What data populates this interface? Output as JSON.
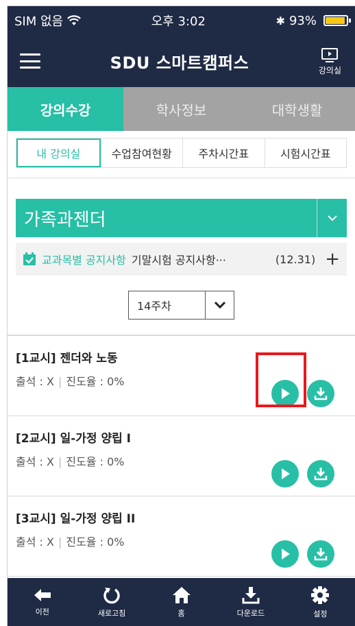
{
  "status_bar": {
    "carrier": "SIM 없음",
    "time": "오후 3:02",
    "battery": "93%",
    "battery_level": 0.93
  },
  "header": {
    "title": "SDU 스마트캠퍼스",
    "right_label": "강의실"
  },
  "main_tabs": [
    {
      "label": "강의수강",
      "active": true
    },
    {
      "label": "학사정보",
      "active": false
    },
    {
      "label": "대학생활",
      "active": false
    }
  ],
  "sub_tabs": [
    {
      "label": "내 강의실",
      "active": true
    },
    {
      "label": "수업참여현황",
      "active": false
    },
    {
      "label": "주차시간표",
      "active": false
    },
    {
      "label": "시험시간표",
      "active": false
    }
  ],
  "course": {
    "name": "가족과젠더"
  },
  "notice": {
    "label": "교과목별 공지사항",
    "text": "기말시험 공지사항···",
    "date": "(12.31)",
    "plus": "+"
  },
  "week_select": {
    "value": "14주차"
  },
  "lectures": [
    {
      "title": "[1교시] 젠더와 노동",
      "attendance": "출석 : X",
      "progress": "진도율 : 0%"
    },
    {
      "title": "[2교시] 일-가정 양립 I",
      "attendance": "출석 : X",
      "progress": "진도율 : 0%"
    },
    {
      "title": "[3교시] 일-가정 양립 II",
      "attendance": "출석 : X",
      "progress": "진도율 : 0%"
    }
  ],
  "bottom_nav": [
    {
      "label": "이전",
      "icon": "arrow-left-icon"
    },
    {
      "label": "새로고침",
      "icon": "refresh-icon"
    },
    {
      "label": "홈",
      "icon": "home-icon"
    },
    {
      "label": "다운로드",
      "icon": "download-icon"
    },
    {
      "label": "설정",
      "icon": "gear-icon"
    }
  ],
  "colors": {
    "navy": "#1f2a44",
    "accent": "#27bfa5",
    "tab_inactive": "#a3a3a3",
    "highlight": "#e8191d"
  }
}
